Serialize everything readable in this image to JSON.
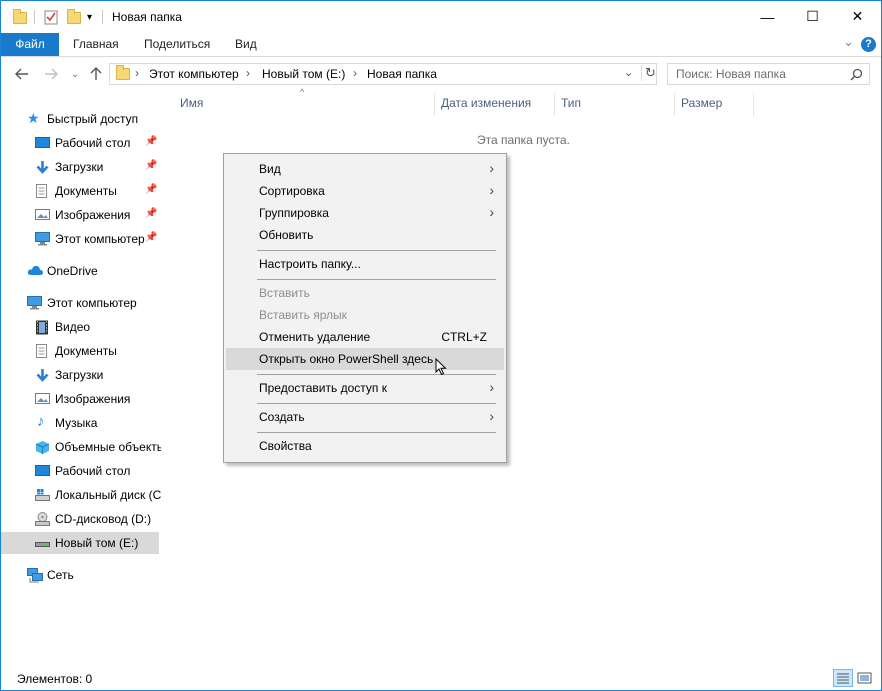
{
  "window": {
    "title": "Новая папка",
    "minimize_glyph": "—",
    "maximize_glyph": "☐",
    "close_glyph": "✕"
  },
  "ribbon": {
    "tabs": [
      {
        "label": "Файл"
      },
      {
        "label": "Главная"
      },
      {
        "label": "Поделиться"
      },
      {
        "label": "Вид"
      }
    ],
    "expand_glyph": "⌄",
    "help_glyph": "?"
  },
  "address": {
    "crumbs": [
      "Этот компьютер",
      "Новый том (E:)",
      "Новая папка"
    ],
    "separator": "›",
    "search_placeholder": "Поиск: Новая папка"
  },
  "nav": {
    "quick_access": "Быстрый доступ",
    "quick_items": [
      "Рабочий стол",
      "Загрузки",
      "Документы",
      "Изображения",
      "Этот компьютер"
    ],
    "onedrive": "OneDrive",
    "this_pc": "Этот компьютер",
    "pc_items": [
      "Видео",
      "Документы",
      "Загрузки",
      "Изображения",
      "Музыка",
      "Объемные объекты",
      "Рабочий стол",
      "Локальный диск (C:)",
      "CD-дисковод (D:)",
      "Новый том (E:)"
    ],
    "network": "Сеть"
  },
  "columns": {
    "name": "Имя",
    "date": "Дата изменения",
    "type": "Тип",
    "size": "Размер"
  },
  "content": {
    "empty_message": "Эта папка пуста."
  },
  "context_menu": {
    "view": "Вид",
    "sort": "Сортировка",
    "group": "Группировка",
    "refresh": "Обновить",
    "customize": "Настроить папку...",
    "paste": "Вставить",
    "paste_shortcut": "Вставить ярлык",
    "undo_delete": "Отменить удаление",
    "undo_shortcut": "CTRL+Z",
    "powershell": "Открыть окно PowerShell здесь",
    "share": "Предоставить доступ к",
    "new": "Создать",
    "properties": "Свойства"
  },
  "status": {
    "items": "Элементов: 0"
  },
  "colors": {
    "accent": "#1979ca",
    "selected_bg": "#d9d9d9",
    "folder": "#f8d775"
  }
}
